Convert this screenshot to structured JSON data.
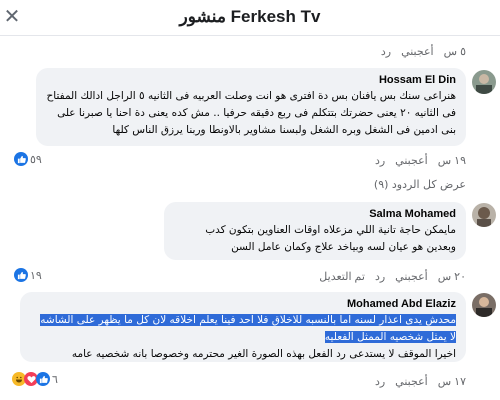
{
  "header": {
    "title": "منشور Ferkesh Tv"
  },
  "top_actions": {
    "time": "٥ س",
    "like": "أعجبني",
    "reply": "رد"
  },
  "comments": [
    {
      "author": "Hossam El Din",
      "text": "هنراعى سنك بس يافنان بس دة افترى هو انت وصلت العربيه فى الثانيه ٥ الراجل ادالك المفتاح فى الثانيه ٢٠ يعنى حضرتك بتتكلم فى ربع دقيقه حرفيا .. مش كده يعنى دة احنا يا صبرنا على بنى ادمين فى الشغل وبره الشغل ولبسنا مشاوير بالاونطا وربنا يرزق الناس كلها",
      "time": "١٩ س",
      "like": "أعجبني",
      "reply": "رد",
      "reactions_count": "٥٩"
    },
    {
      "author": "Salma Mohamed",
      "text": "مايمكن حاجة تانية اللي مزعلاه اوقات العناوين بتكون كدب وبعدين هو عيان لسه وبياخد علاج وكمان عامل السن",
      "time": "٢٠ س",
      "like": "أعجبني",
      "reply": "رد",
      "edited": "تم التعديل",
      "reactions_count": "١٩"
    },
    {
      "author": "Mohamed Abd Elaziz",
      "text_highlight_1": "محدش يدى اعذار لسنه اما بالنسبه للاخلاق فلا احد فينا يعلم اخلاقه لان كل ما يظهر على الشاشه",
      "text_highlight_2": "لا يمثل شخصيه الممثل الفعليه",
      "text_plain": "اخيرا الموقف لا يستدعى رد الفعل بهذه الصورة الغير محترمه وخصوصا بانه شخصيه عامه",
      "time": "١٧ س",
      "like": "أعجبني",
      "reply": "رد",
      "reactions_count": "٦"
    }
  ],
  "show_replies": "عرض كل الردود (٩)",
  "colors": {
    "like_blue": "#1b74e4",
    "bubble_bg": "#f0f2f5",
    "highlight": "#2f6bd8"
  },
  "icons": {
    "close": "close-icon",
    "like": "thumbs-up-icon",
    "love": "heart-icon",
    "haha": "laugh-icon"
  }
}
